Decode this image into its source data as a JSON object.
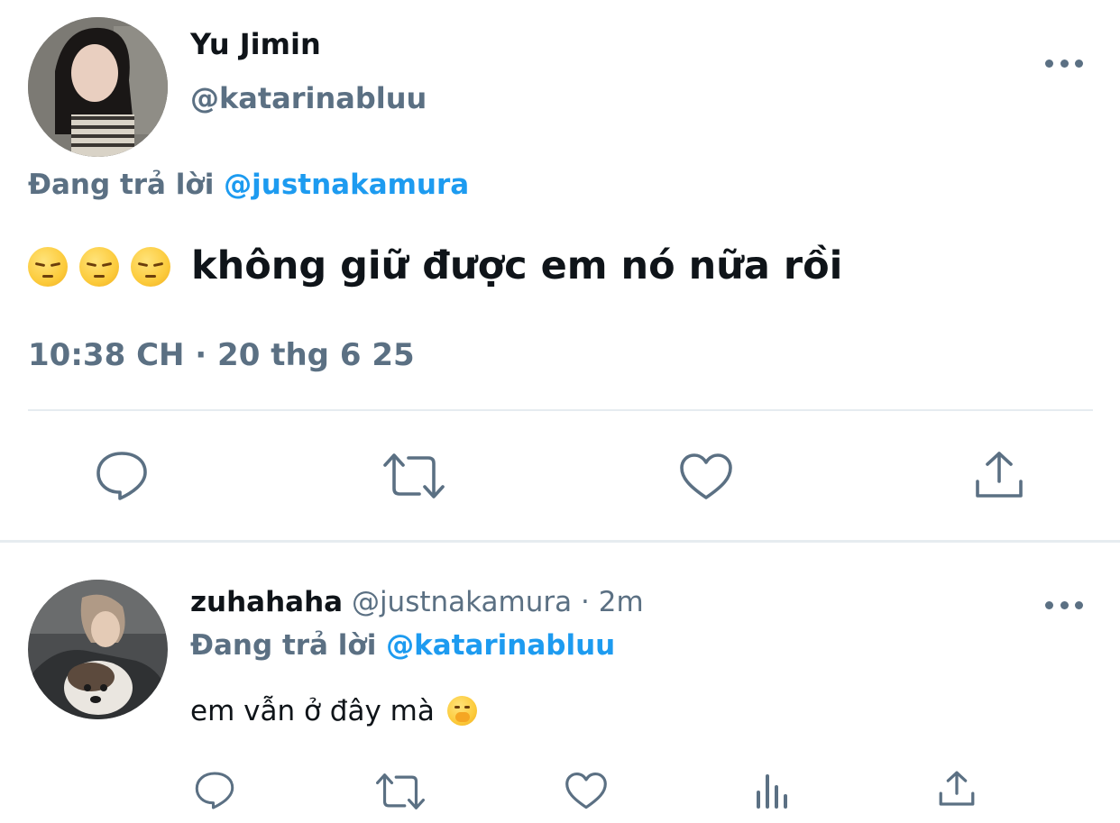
{
  "main_tweet": {
    "display_name": "Yu Jimin",
    "handle": "@katarinabluu",
    "replying_prefix": "Đang trả lời",
    "replying_to": "@justnakamura",
    "emojis": [
      "pensive-face",
      "pensive-face",
      "pensive-face"
    ],
    "text": "không giữ được em nó nữa rồi",
    "timestamp": "10:38 CH · 20 thg 6 25",
    "avatar": "profile-photo-woman",
    "actions": [
      "reply-icon",
      "retweet-icon",
      "like-icon",
      "share-icon"
    ]
  },
  "reply_tweet": {
    "display_name": "zuhahaha",
    "handle": "@justnakamura",
    "separator": "·",
    "time_ago": "2m",
    "replying_prefix": "Đang trả lời",
    "replying_to": "@katarinabluu",
    "text": "em vẫn ở đây mà",
    "emoji": "face-with-hand-over-mouth",
    "avatar": "profile-photo-woman-with-dog",
    "actions": [
      "reply-icon",
      "retweet-icon",
      "like-icon",
      "views-icon",
      "share-icon"
    ]
  },
  "colors": {
    "text": "#0f1419",
    "secondary": "#5b7083",
    "link": "#1d9bf0",
    "divider": "#e6ecf0"
  }
}
